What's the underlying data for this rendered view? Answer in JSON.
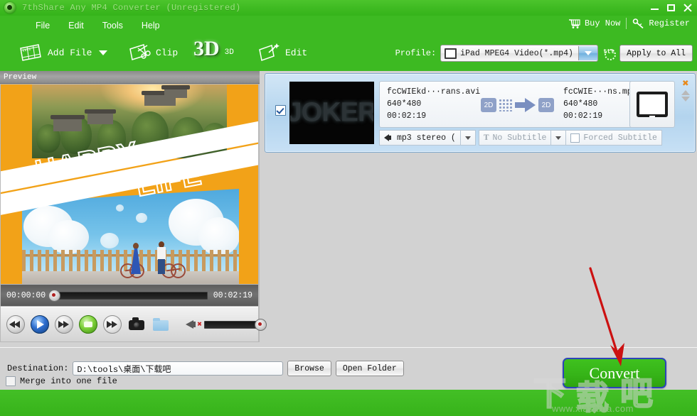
{
  "window": {
    "title": "7thShare Any MP4 Converter (Unregistered)",
    "logo_icon": "app-logo-icon",
    "minimize_icon": "minimize-icon",
    "maximize_icon": "maximize-icon",
    "close_icon": "close-icon",
    "titlebar_color": "#3fbb22",
    "title_text_color": "#9be07f"
  },
  "menu": {
    "items": [
      {
        "label": "File"
      },
      {
        "label": "Edit"
      },
      {
        "label": "Tools"
      },
      {
        "label": "Help"
      }
    ]
  },
  "account": {
    "buy_label": "Buy Now",
    "buy_icon": "shopping-cart-icon",
    "register_label": "Register",
    "register_icon": "key-icon"
  },
  "toolbar": {
    "add_file_label": "Add File",
    "add_file_icon": "film-strip-icon",
    "add_file_caret_icon": "caret-down-icon",
    "clip_label": "Clip",
    "clip_icon": "scissors-icon",
    "three_d_glyph": "3D",
    "three_d_label": "3D",
    "three_d_icon": "three-d-icon",
    "edit_label": "Edit",
    "edit_icon": "magic-wand-icon"
  },
  "profile": {
    "label": "Profile:",
    "value": "iPad MPEG4 Video(*.mp4)",
    "device_icon": "tablet-icon",
    "dropdown_icon": "caret-down-icon",
    "settings_icon": "gear-icon",
    "settings_glyph": "⚙",
    "apply_label": "Apply to All"
  },
  "preview": {
    "panel_title": "Preview",
    "poster": {
      "line1": "HAPPY",
      "line2": "LIFE",
      "bg_color": "#f2a218"
    },
    "current_time": "00:00:00",
    "total_time": "00:02:19",
    "seek_position_percent": 0,
    "volume_percent": 100,
    "muted": true,
    "controls": [
      {
        "name": "rewind-button",
        "icon": "rewind-icon"
      },
      {
        "name": "play-button",
        "icon": "play-icon"
      },
      {
        "name": "fast-forward-button",
        "icon": "fast-forward-icon"
      },
      {
        "name": "stop-button",
        "icon": "stop-icon"
      },
      {
        "name": "next-frame-button",
        "icon": "next-frame-icon"
      },
      {
        "name": "snapshot-button",
        "icon": "camera-icon"
      },
      {
        "name": "open-snapshot-folder-button",
        "icon": "folder-icon"
      }
    ],
    "volume_icon": "speaker-muted-icon"
  },
  "filelist": {
    "rows": [
      {
        "checked": true,
        "thumbnail_text": "JOKER",
        "source": {
          "filename": "fcCWIEkd···rans.avi",
          "resolution": "640*480",
          "duration": "00:02:19",
          "dimension_badge": "2D"
        },
        "target": {
          "filename": "fcCWIE···ns.mp",
          "resolution": "640*480",
          "duration": "00:02:19",
          "dimension_badge": "2D"
        },
        "device_icon": "tablet-icon",
        "audio_track": "mp3 stereo (",
        "subtitle_track": "No Subtitle",
        "subtitle_icon": "text-subtitle-icon",
        "forced_subtitle_label": "Forced Subtitle",
        "forced_subtitle_checked": false,
        "remove_icon": "close-x-icon",
        "move_up_icon": "caret-up-icon",
        "move_down_icon": "caret-down-icon"
      }
    ]
  },
  "footer": {
    "destination_label": "Destination:",
    "destination_value": "D:\\tools\\桌面\\下载吧",
    "browse_label": "Browse",
    "open_folder_label": "Open Folder",
    "merge_label": "Merge into one file",
    "merge_checked": false,
    "convert_label": "Convert",
    "convert_button_color": "#36b418",
    "convert_border_color": "#2b44b8"
  },
  "annotation": {
    "arrow_color": "#cc1111",
    "arrow_target": "convert-button"
  },
  "watermark": {
    "char1": "下",
    "char2": "载",
    "char3": "吧",
    "url": "www.xiazaiba.com"
  }
}
